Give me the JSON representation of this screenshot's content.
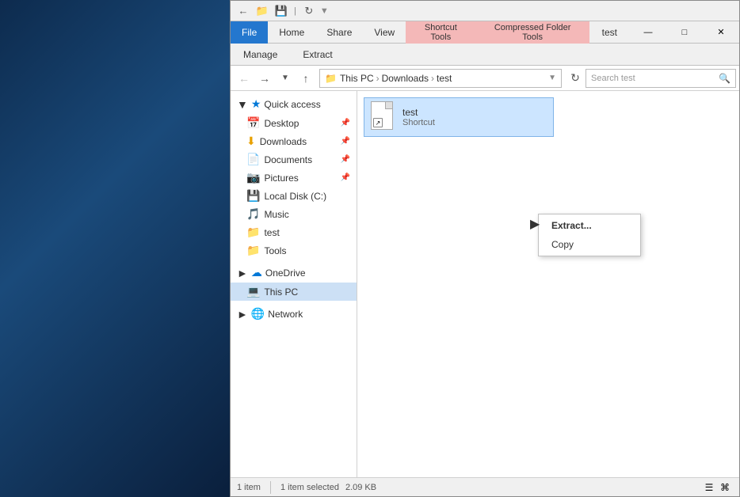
{
  "window": {
    "title": "test"
  },
  "ribbon": {
    "tabs": {
      "file": "File",
      "home": "Home",
      "share": "Share",
      "view": "View",
      "manage": "Manage",
      "extract": "Extract",
      "shortcut_tools": "Shortcut Tools",
      "compressed_folder_tools": "Compressed Folder Tools"
    }
  },
  "address_bar": {
    "path": "This PC › Downloads › test",
    "this_pc": "This PC",
    "downloads": "Downloads",
    "test": "test",
    "search_placeholder": "Search test"
  },
  "nav_pane": {
    "quick_access": "Quick access",
    "desktop": "Desktop",
    "downloads": "Downloads",
    "documents": "Documents",
    "pictures": "Pictures",
    "local_disk": "Local Disk (C:)",
    "music": "Music",
    "test": "test",
    "tools": "Tools",
    "onedrive": "OneDrive",
    "this_pc": "This PC",
    "network": "Network"
  },
  "file_area": {
    "file_name": "test",
    "file_type": "Shortcut"
  },
  "context_menu": {
    "extract": "Extract...",
    "copy": "Copy"
  },
  "status_bar": {
    "item_count": "1 item",
    "selected": "1 item selected",
    "size": "2.09 KB"
  }
}
